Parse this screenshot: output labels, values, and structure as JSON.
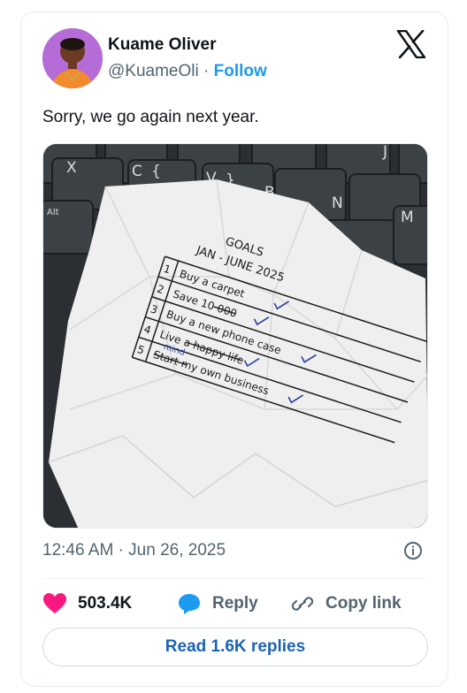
{
  "tweet": {
    "author_name": "Kuame Oliver",
    "handle": "@KuameOli",
    "separator": "·",
    "follow_label": "Follow",
    "text": "Sorry, we go again next year.",
    "timestamp": "12:46 AM · Jun 26, 2025"
  },
  "photo": {
    "keyboard_keys": [
      "X",
      "C",
      "{",
      "V",
      "}",
      "B",
      "N",
      "J",
      "M",
      "Alt"
    ],
    "note_heading": "GOALS",
    "note_subheading": "JAN - JUNE 2025",
    "goals": [
      {
        "num": "1",
        "text": "Buy a carpet"
      },
      {
        "num": "2",
        "text": "Save 10 000"
      },
      {
        "num": "3",
        "text": "Buy a new phone case"
      },
      {
        "num": "4",
        "text": "Live a happy life"
      },
      {
        "num": "5",
        "text": "Start my own business"
      }
    ],
    "goal_4_insert": "mind"
  },
  "actions": {
    "likes": "503.4K",
    "reply_label": "Reply",
    "copy_label": "Copy link",
    "read_replies_label": "Read 1.6K replies"
  },
  "colors": {
    "accent": "#1d9bf0",
    "like": "#f91880",
    "reply_icon": "#1d9bf0",
    "muted": "#536471"
  },
  "icons": [
    "x-logo-icon",
    "info-icon",
    "heart-icon",
    "reply-bubble-icon",
    "link-icon"
  ]
}
